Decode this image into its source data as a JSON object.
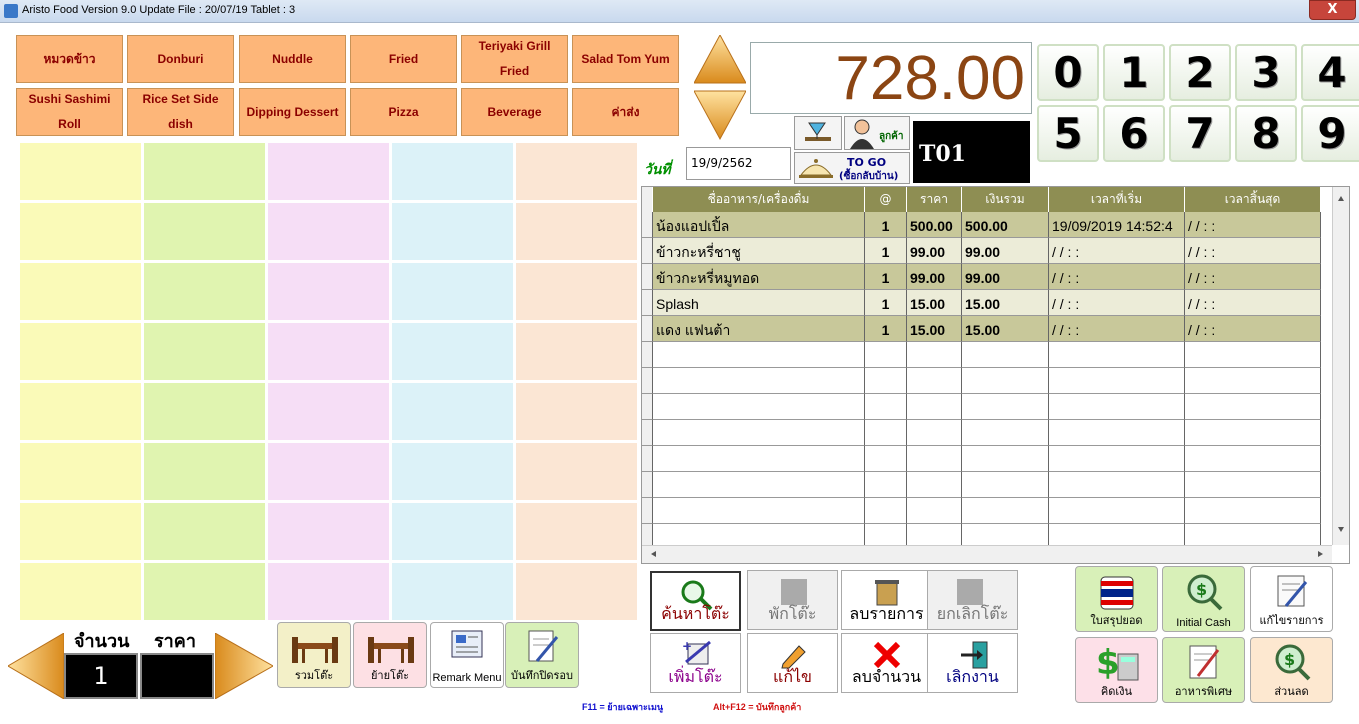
{
  "window": {
    "title": "Aristo Food  Version 9.0 Update File : 20/07/19 Tablet  : 3",
    "close_label": "X"
  },
  "categories": [
    [
      "หมวดข้าว",
      "Donburi",
      "Nuddle",
      "Fried",
      "Teriyaki Grill Fried",
      "Salad Tom Yum"
    ],
    [
      "Sushi Sashimi Roll",
      "Rice Set Side dish",
      "Dipping Dessert",
      "Pizza",
      "Beverage",
      "ค่าส่ง"
    ]
  ],
  "total": "728.00",
  "numpad": [
    "0",
    "1",
    "2",
    "3",
    "4",
    "5",
    "6",
    "7",
    "8",
    "9"
  ],
  "customer_label": "ลูกค้า",
  "togo_label": "TO GO",
  "togo_sub": "(ซื้อกลับบ้าน)",
  "table_number": "T01",
  "date_label": "วันที่",
  "date_value": "19/9/2562",
  "order_grid": {
    "headers": [
      "ชื่ออาหาร/เครื่องดื่ม",
      "@",
      "ราคา",
      "เงินรวม",
      "เวลาที่เริ่ม",
      "เวลาสิ้นสุด"
    ],
    "rows": [
      [
        "น้องแอปเปิ้ล",
        "1",
        "500.00",
        "500.00",
        "19/09/2019 14:52:4",
        "/ /        : :"
      ],
      [
        "ข้าวกะหรี่ชาชู",
        "1",
        "99.00",
        "99.00",
        "/ /        : :",
        "/ /        : :"
      ],
      [
        "ข้าวกะหรี่หมูทอด",
        "1",
        "99.00",
        "99.00",
        "/ /        : :",
        "/ /        : :"
      ],
      [
        "Splash",
        "1",
        "15.00",
        "15.00",
        "/ /        : :",
        "/ /        : :"
      ],
      [
        "แดง แฟนต้า",
        "1",
        "15.00",
        "15.00",
        "/ /        : :",
        "/ /        : :"
      ]
    ],
    "empty_rows": 8
  },
  "actions": {
    "find_table": "ค้นหาโต๊ะ",
    "hold_table": "พักโต๊ะ",
    "delete_item": "ลบรายการ",
    "cancel_table": "ยกเลิกโต๊ะ",
    "add_table": "เพิ่มโต๊ะ",
    "edit": "แก้ไข",
    "delete_qty": "ลบจำนวน",
    "quit": "เลิกงาน"
  },
  "right_buttons": {
    "summary": "ใบสรุปยอด",
    "initial_cash": "Initial Cash",
    "edit_items": "แก้ไขรายการ",
    "calc_money": "คิดเงิน",
    "special_food": "อาหารพิเศษ",
    "discount": "ส่วนลด"
  },
  "qty_label": "จำนวน",
  "price_label": "ราคา",
  "qty_value": "1",
  "price_value": "",
  "bottom_buttons": {
    "merge_table": "รวมโต๊ะ",
    "move_table": "ย้ายโต๊ะ",
    "remark_menu": "Remark Menu",
    "save_close": "บันทึกปิดรอบ"
  },
  "hints": {
    "f11": "F11 = ย้ายเฉพาะเมนู",
    "altf12": "Alt+F12 = บันทึกลูกค้า"
  },
  "colors": {
    "category_bg": "#fdb679",
    "category_text": "#8b0000",
    "grid_header": "#8e8e53",
    "grid_row_alt": "#c8c89a",
    "total_text": "#8b4513"
  }
}
